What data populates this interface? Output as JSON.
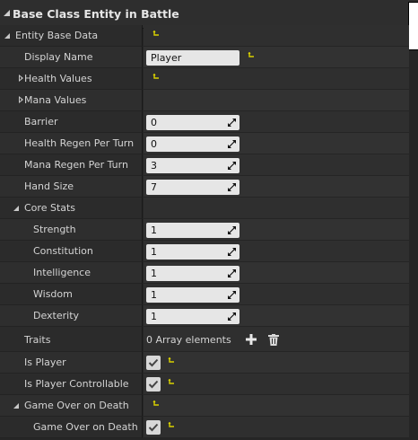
{
  "header": {
    "title": "Base Class Entity in Battle"
  },
  "rows": {
    "entity_base_data": "Entity Base Data",
    "display_name": {
      "label": "Display Name",
      "value": "Player"
    },
    "health_values": "Health Values",
    "mana_values": "Mana Values",
    "barrier": {
      "label": "Barrier",
      "value": "0"
    },
    "health_regen": {
      "label": "Health Regen Per Turn",
      "value": "0"
    },
    "mana_regen": {
      "label": "Mana Regen Per Turn",
      "value": "3"
    },
    "hand_size": {
      "label": "Hand Size",
      "value": "7"
    },
    "core_stats": "Core Stats",
    "strength": {
      "label": "Strength",
      "value": "1"
    },
    "constitution": {
      "label": "Constitution",
      "value": "1"
    },
    "intelligence": {
      "label": "Intelligence",
      "value": "1"
    },
    "wisdom": {
      "label": "Wisdom",
      "value": "1"
    },
    "dexterity": {
      "label": "Dexterity",
      "value": "1"
    },
    "traits": {
      "label": "Traits",
      "value": "0 Array elements"
    },
    "is_player": {
      "label": "Is Player",
      "checked": true
    },
    "is_player_controllable": {
      "label": "Is Player Controllable",
      "checked": true
    },
    "game_over_group": "Game Over on Death",
    "game_over_on_death": {
      "label": "Game Over on Death",
      "checked": true
    }
  },
  "icons": {
    "reset": "reset-to-default-icon",
    "spin": "spin-drag-icon",
    "add": "add-element-icon",
    "delete": "delete-all-icon",
    "check": "checkmark-icon"
  },
  "colors": {
    "reset_icon": "#d8d000",
    "field_bg": "#e6e6e6",
    "panel_bg": "#262626"
  }
}
